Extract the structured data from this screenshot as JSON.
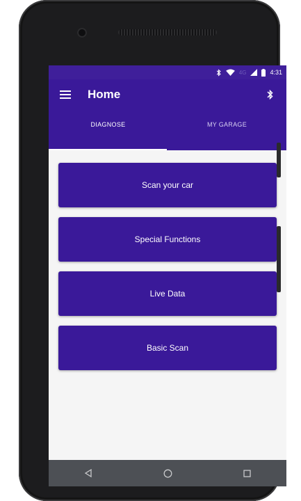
{
  "status_bar": {
    "time": "4:31",
    "network_label": "4G",
    "icons": [
      "bluetooth-icon",
      "wifi-icon",
      "signal-icon",
      "battery-icon"
    ]
  },
  "app_bar": {
    "title": "Home",
    "menu_icon": "hamburger-menu-icon",
    "action_icon": "bluetooth-icon"
  },
  "tabs": [
    {
      "label": "DIAGNOSE",
      "selected": true
    },
    {
      "label": "MY GARAGE",
      "selected": false
    }
  ],
  "main": {
    "buttons": [
      {
        "label": "Scan your car"
      },
      {
        "label": "Special Functions"
      },
      {
        "label": "Live Data"
      },
      {
        "label": "Basic Scan"
      }
    ]
  },
  "nav_bar": {
    "icons": [
      "back-icon",
      "home-icon",
      "recents-icon"
    ]
  },
  "colors": {
    "primary": "#3a1999",
    "status_bar": "#3f1f9a",
    "background": "#f5f5f5",
    "nav_bar": "#4d5055"
  }
}
